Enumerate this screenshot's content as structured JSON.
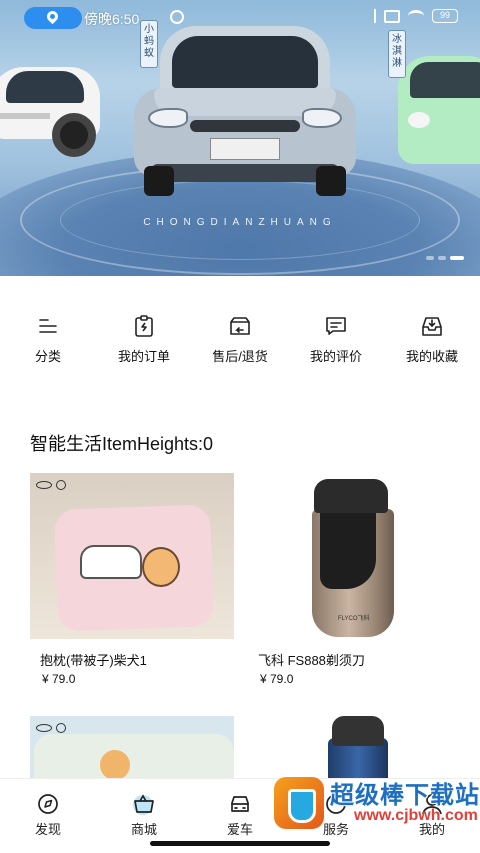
{
  "status_bar": {
    "time": "傍晚6:50",
    "battery": "99"
  },
  "banner": {
    "tag_left": "小蚂蚁",
    "tag_right": "冰淇淋",
    "bottom_text": "CHONGDIANZHUANG",
    "slide_count": 3,
    "active_slide": 3
  },
  "quick_menu": [
    {
      "label": "分类",
      "icon": "category-list-icon"
    },
    {
      "label": "我的订单",
      "icon": "order-clipboard-icon"
    },
    {
      "label": "售后/退货",
      "icon": "return-box-icon"
    },
    {
      "label": "我的评价",
      "icon": "review-comment-icon"
    },
    {
      "label": "我的收藏",
      "icon": "favorite-inbox-icon"
    }
  ],
  "section": {
    "title": "智能生活ItemHeights:0"
  },
  "products": [
    {
      "name": "抱枕(带被子)柴犬1",
      "price": "¥ 79.0",
      "image": "pillow"
    },
    {
      "name": "飞科 FS888剃须刀",
      "price": "¥ 79.0",
      "image": "shaver",
      "brand_text": "FLYCO飞科"
    }
  ],
  "bottom_nav": [
    {
      "label": "发现",
      "icon": "discover-compass-icon"
    },
    {
      "label": "商城",
      "icon": "mall-basket-icon",
      "active": true
    },
    {
      "label": "爱车",
      "icon": "car-icon"
    },
    {
      "label": "服务",
      "icon": "service-icon"
    },
    {
      "label": "我的",
      "icon": "profile-icon"
    }
  ],
  "watermark": {
    "title": "超级棒下载站",
    "url": "www.cjbwh.com"
  },
  "colors": {
    "accent": "#2e8ef0",
    "mall_active": "#3cb6e8",
    "watermark_blue": "#1d6fc1",
    "watermark_red": "#e0403a"
  }
}
